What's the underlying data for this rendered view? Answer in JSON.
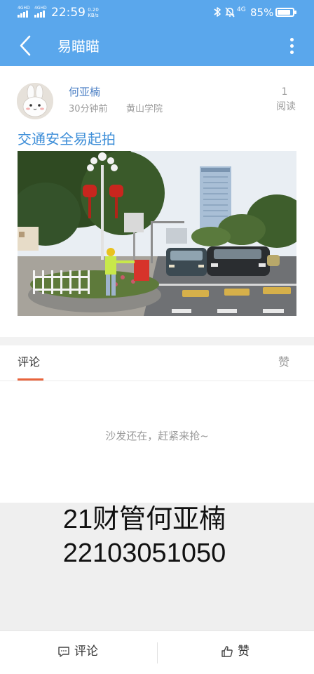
{
  "status_bar": {
    "sim1_label": "4GHD",
    "sim2_label": "4GHD",
    "time": "22:59",
    "speed_value": "0.20",
    "speed_unit": "KB/s",
    "network_label": "4G",
    "battery_pct": "85%",
    "battery_level": 0.85
  },
  "app_bar": {
    "title": "易瞄瞄",
    "icons": [
      "back-arrow-icon",
      "more-vertical-icon"
    ]
  },
  "post": {
    "author": "何亚楠",
    "time_ago": "30分钟前",
    "school": "黄山学院",
    "read_count": "1",
    "read_label": "阅读",
    "title": "交通安全易起拍"
  },
  "tabs": {
    "comments": "评论",
    "likes": "赞"
  },
  "comments": {
    "empty_text": "沙发还在，赶紧来抢~"
  },
  "overlay": {
    "line1": "21财管何亚楠",
    "line2": "22103051050"
  },
  "bottom_bar": {
    "comment_label": "评论",
    "like_label": "赞"
  },
  "colors": {
    "app_bar": "#5aa7ec",
    "author": "#4b7fc4",
    "title_link": "#3d8ed8",
    "tab_indicator": "#e8643c"
  }
}
